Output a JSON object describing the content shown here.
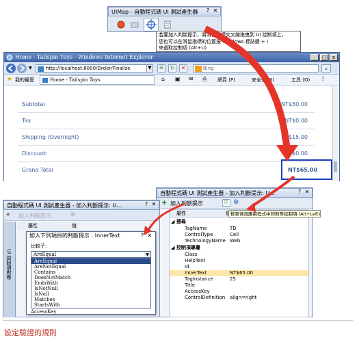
{
  "uimap": {
    "title": "UIMap - 自動程式碼 UI 測試產生器",
    "help": "?",
    "close": "✕",
    "tooltip_lines": [
      "將滑鼠游標交叉線拖曳到 UI 控制項上，",
      "您也可以在滑鼠指標的位置按 Windows 標誌鍵 + I",
      "來選取控制項 (Alt+U)"
    ],
    "tooltip_prefix": "若要加入判斷提示，"
  },
  "ie": {
    "title": "Home - Tailspin Toys - Windows Internet Explorer",
    "url": "http://localhost:8000/Order/Finalize",
    "search_placeholder": "Bing",
    "favorites_label": "我的最愛",
    "tab_label": "Home - Tailspin Toys",
    "menu": [
      "網頁 (P)",
      "安全性 (S)",
      "工具 (O)"
    ],
    "help": "?"
  },
  "order": {
    "rows": [
      {
        "label": "Subtotal",
        "value": "NT$50.00"
      },
      {
        "label": "Tax",
        "value": "NT$0.00"
      },
      {
        "label": "Shipping (Overnight)",
        "value": "NT$15.00"
      },
      {
        "label": "Discount:",
        "value": "-NT$0.00"
      },
      {
        "label": "Grand Total",
        "value": "NT$65.00"
      }
    ]
  },
  "builder_left": {
    "title": "自動程式碼 UI 測試產生器 - 加入判斷提示: U...",
    "help": "?",
    "close": "✕",
    "add_assert": "加入判斷提示",
    "side_label": "UI 控制項對應",
    "header_prop": "屬性",
    "header_val": "值"
  },
  "assert_dialog": {
    "title": "加入下列項目的判斷提示 : InnerText",
    "help": "?",
    "close": "✕",
    "comparator_label": "比較子:",
    "selected": "AreEqual",
    "options": [
      "AreEqual",
      "AreNotEqual",
      "Contains",
      "DoesNotMatch",
      "EndsWith",
      "IsNotNull",
      "IsNull",
      "Matches",
      "StartsWith"
    ],
    "footer_item": "AccessKey"
  },
  "builder_right": {
    "title": "自動程式碼 UI 測試產生器 - 加入判斷提示: U...",
    "help": "?",
    "close": "✕",
    "add_assert": "加入判斷提示",
    "col_prop": "屬性",
    "col_val_hint": "值",
    "tooltip": "移至待測應用程式中的對等控制項 (Alt+Left)",
    "group1": "搜尋",
    "group1_rows": [
      {
        "name": "TagName",
        "value": "TD"
      },
      {
        "name": "ControlType",
        "value": "Cell"
      },
      {
        "name": "TechnologyName",
        "value": "Web"
      }
    ],
    "group2": "控制項專屬",
    "group2_rows": [
      {
        "name": "Class",
        "value": ""
      },
      {
        "name": "HelpText",
        "value": ""
      },
      {
        "name": "Id",
        "value": ""
      },
      {
        "name": "InnerText",
        "value": "NT$65.00"
      },
      {
        "name": "TagInstance",
        "value": "25"
      },
      {
        "name": "Title",
        "value": ""
      },
      {
        "name": "AccessKey",
        "value": ""
      },
      {
        "name": "ControlDefinition",
        "value": "align=right"
      }
    ]
  },
  "caption": "設定驗證的規則",
  "colors": {
    "arrow": "#e5352b",
    "highlight": "#1a3fb8",
    "accent": "#3a5c9a"
  }
}
